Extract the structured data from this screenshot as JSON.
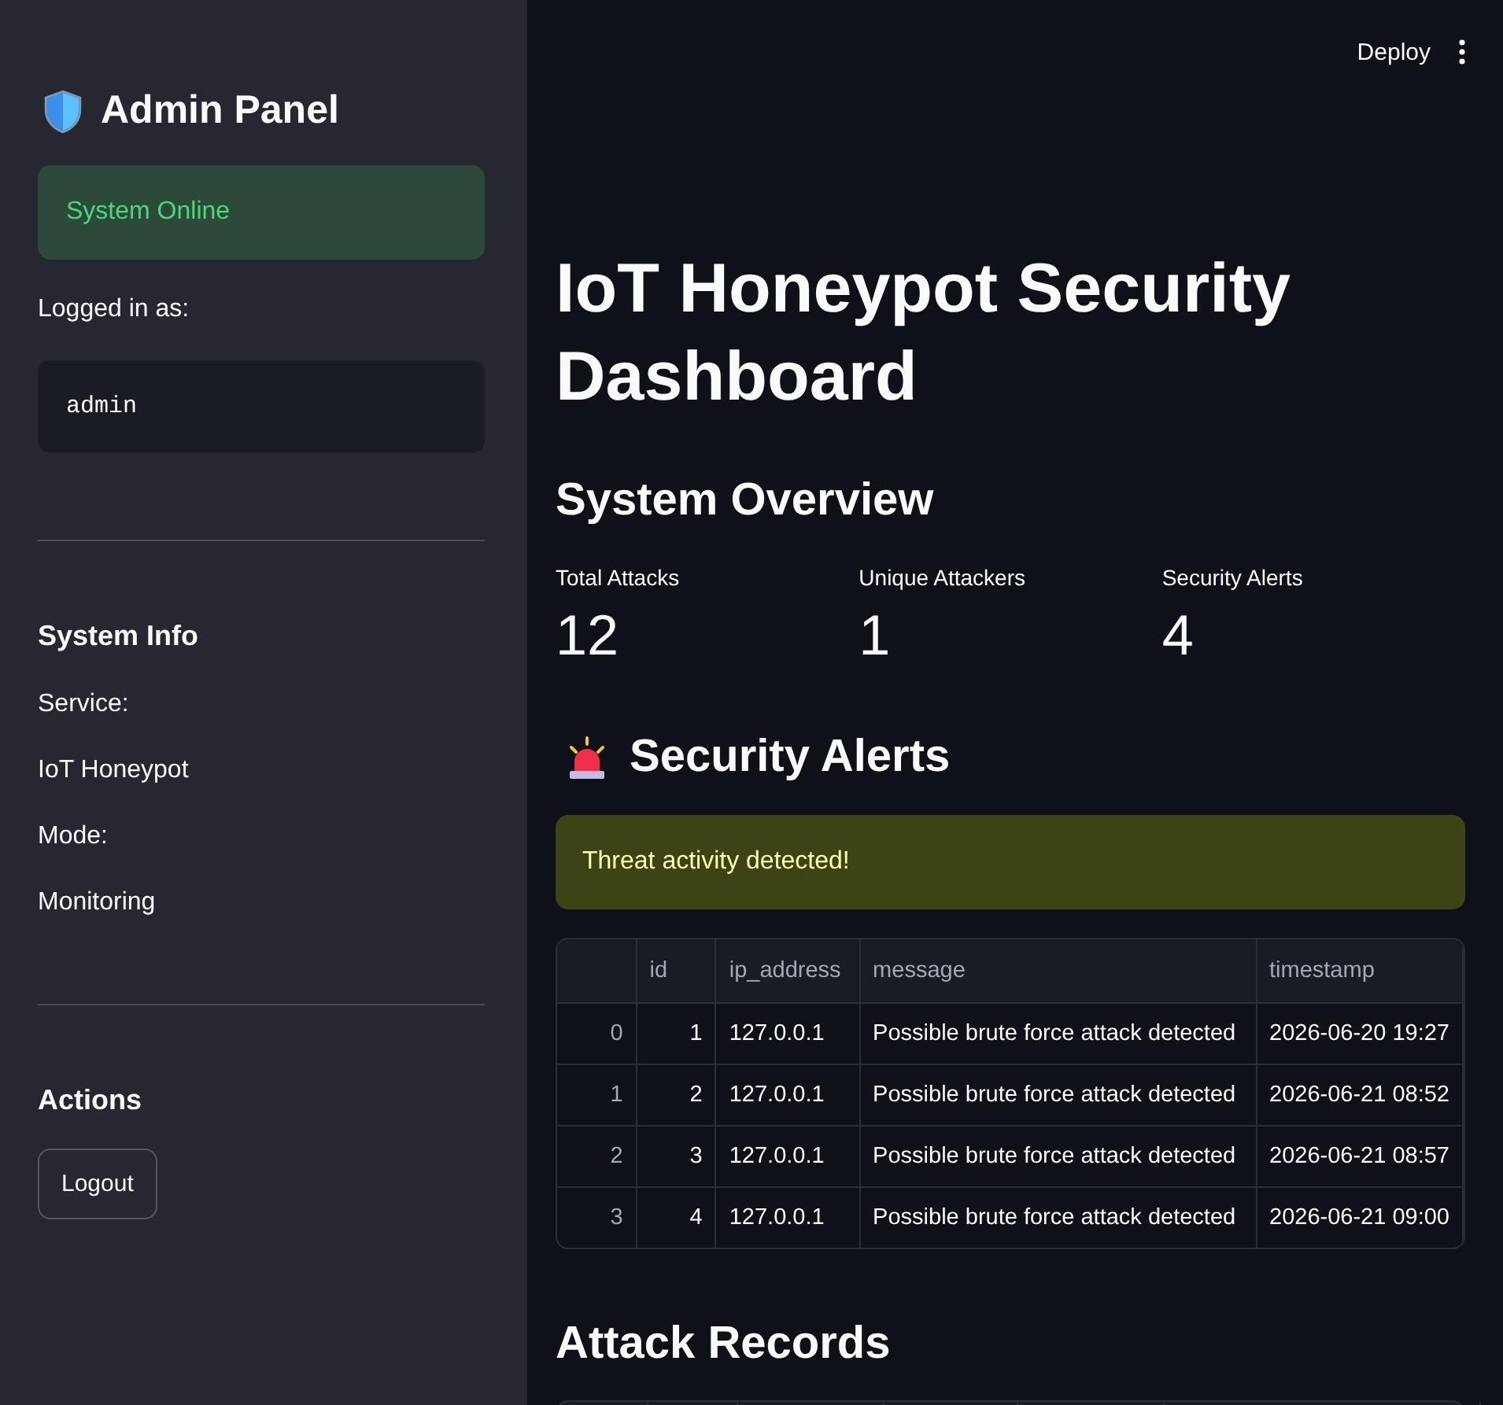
{
  "sidebar": {
    "title": "Admin Panel",
    "status": "System Online",
    "logged_label": "Logged in as:",
    "user": "admin",
    "info_heading": "System Info",
    "info": [
      "Service:",
      "IoT Honeypot",
      "Mode:",
      "Monitoring"
    ],
    "actions_heading": "Actions",
    "logout_button": "Logout"
  },
  "toolbar": {
    "deploy": "Deploy"
  },
  "main": {
    "title": "IoT Honeypot Security Dashboard",
    "overview_heading": "System Overview",
    "metrics": [
      {
        "label": "Total Attacks",
        "value": "12"
      },
      {
        "label": "Unique Attackers",
        "value": "1"
      },
      {
        "label": "Security Alerts",
        "value": "4"
      }
    ],
    "alerts_heading": "Security Alerts",
    "warning": "Threat activity detected!",
    "alerts_table": {
      "columns": [
        "id",
        "ip_address",
        "message",
        "timestamp"
      ],
      "rows": [
        {
          "index": "0",
          "cells": [
            "1",
            "127.0.0.1",
            "Possible brute force attack detected",
            "2026-06-20 19:27"
          ]
        },
        {
          "index": "1",
          "cells": [
            "2",
            "127.0.0.1",
            "Possible brute force attack detected",
            "2026-06-21 08:52"
          ]
        },
        {
          "index": "2",
          "cells": [
            "3",
            "127.0.0.1",
            "Possible brute force attack detected",
            "2026-06-21 08:57"
          ]
        },
        {
          "index": "3",
          "cells": [
            "4",
            "127.0.0.1",
            "Possible brute force attack detected",
            "2026-06-21 09:00"
          ]
        }
      ]
    },
    "records_heading": "Attack Records"
  }
}
